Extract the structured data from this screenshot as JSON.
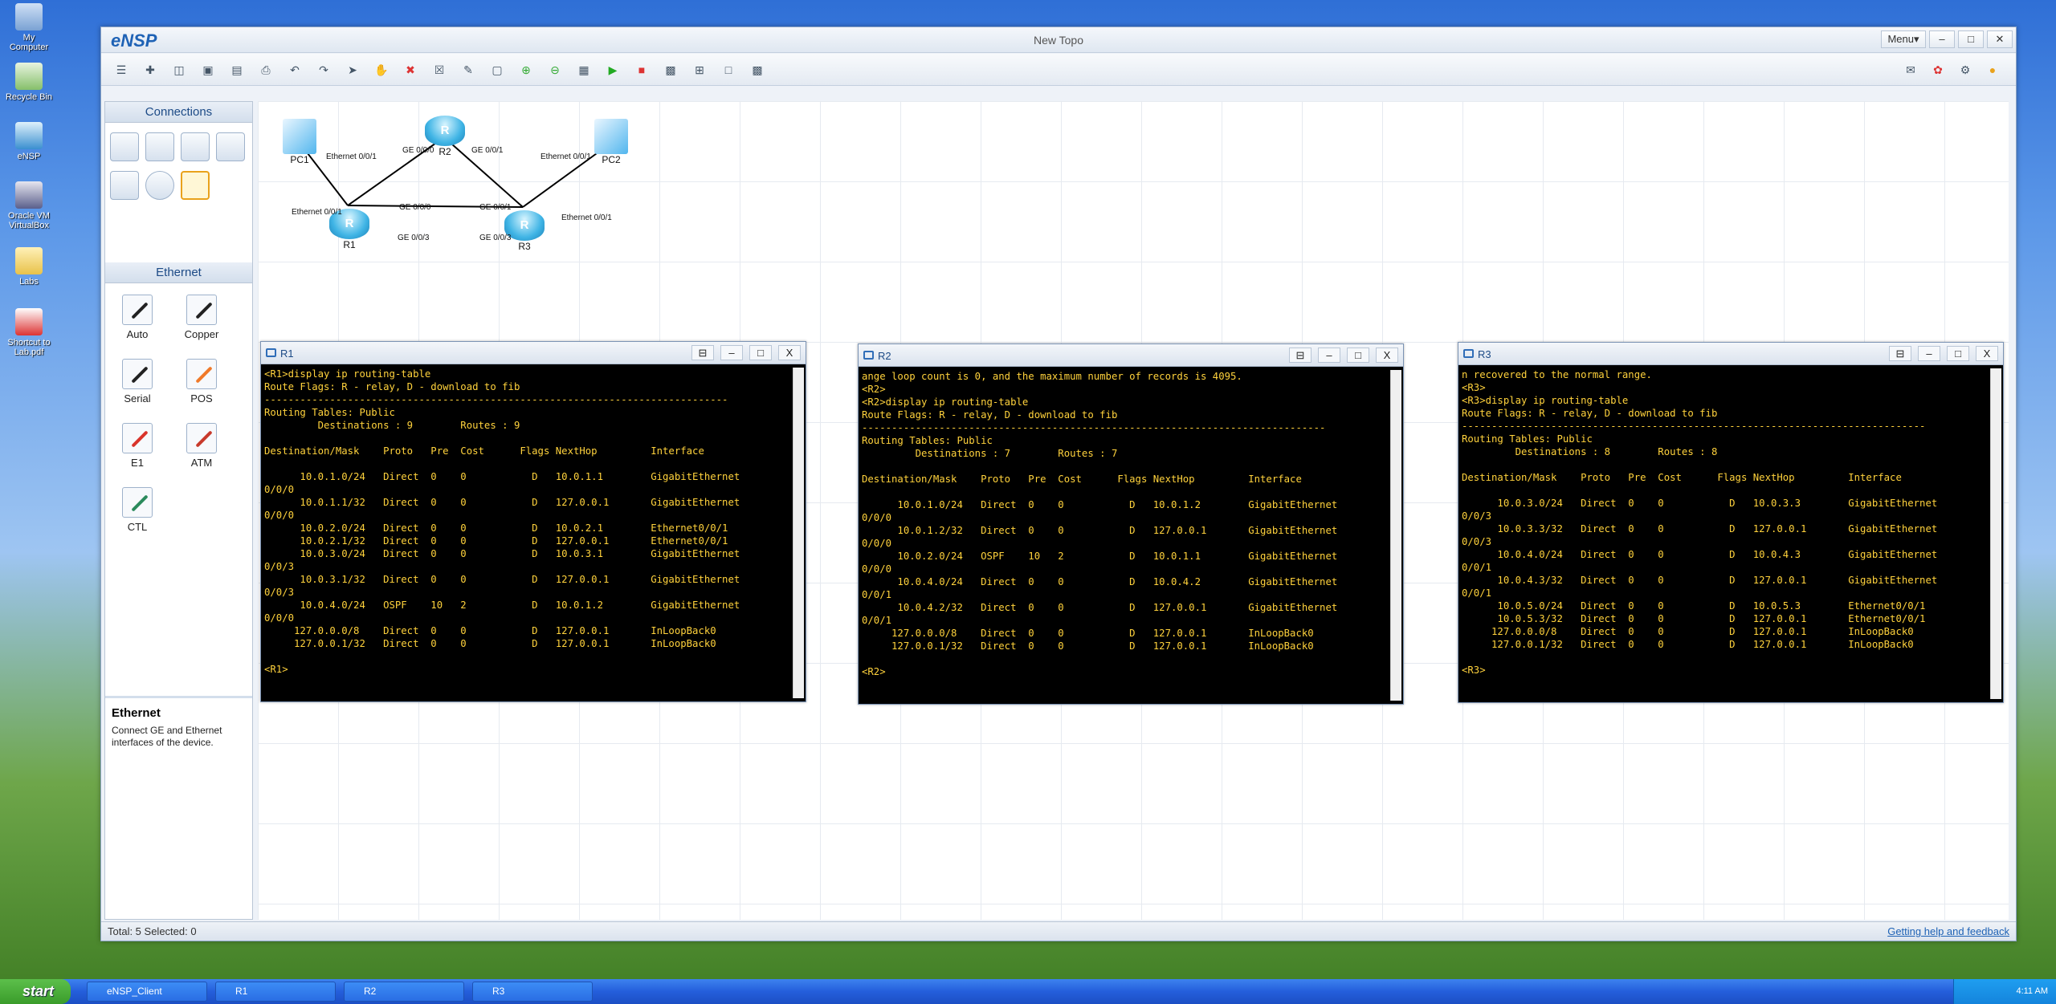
{
  "desktop": {
    "icons": [
      {
        "label": "My Computer",
        "name": "my-computer-icon"
      },
      {
        "label": "Recycle Bin",
        "name": "recycle-bin-icon"
      },
      {
        "label": "eNSP",
        "name": "ensp-icon"
      },
      {
        "label": "Oracle VM VirtualBox",
        "name": "virtualbox-icon"
      },
      {
        "label": "Labs",
        "name": "folder-icon"
      },
      {
        "label": "Shortcut to Lab.pdf",
        "name": "pdf-shortcut-icon"
      }
    ]
  },
  "app": {
    "logo": "eNSP",
    "title": "New Topo",
    "menu": "Menu▾",
    "min": "–",
    "max": "□",
    "close": "✕"
  },
  "panels": {
    "connections": "Connections",
    "ethernet": "Ethernet",
    "cables": [
      {
        "label": "Auto",
        "color": "#222"
      },
      {
        "label": "Copper",
        "color": "#222"
      },
      {
        "label": "Serial",
        "color": "#222"
      },
      {
        "label": "POS",
        "color": "#f07a2a"
      },
      {
        "label": "E1",
        "color": "#d9342b"
      },
      {
        "label": "ATM",
        "color": "#c83a2c"
      },
      {
        "label": "CTL",
        "color": "#2b8a5c"
      }
    ],
    "info_title": "Ethernet",
    "info_text": "Connect GE and Ethernet interfaces of the device."
  },
  "topology": {
    "nodes": {
      "pc1": "PC1",
      "pc2": "PC2",
      "r1": "R1",
      "r2": "R2",
      "r3": "R3"
    },
    "router_glyph": "R",
    "links": {
      "pc1_r1_a": "Ethernet 0/0/1",
      "pc1_r1_b": "Ethernet 0/0/1",
      "r1_r2_a": "GE 0/0/0",
      "r1_r2_b": "GE 0/0/0",
      "r2_r3_a": "GE 0/0/1",
      "r2_r3_b": "GE 0/0/1",
      "r1_r3_a": "GE 0/0/3",
      "r1_r3_b": "GE 0/0/3",
      "pc2_r3_a": "Ethernet 0/0/1",
      "pc2_r3_b": "Ethernet 0/0/1"
    }
  },
  "terminals": {
    "ctl": {
      "restore": "⊟",
      "min": "–",
      "max": "□",
      "close": "X"
    },
    "r1": {
      "title": "R1",
      "text": "<R1>display ip routing-table\nRoute Flags: R - relay, D - download to fib\n------------------------------------------------------------------------------\nRouting Tables: Public\n         Destinations : 9        Routes : 9\n\nDestination/Mask    Proto   Pre  Cost      Flags NextHop         Interface\n\n      10.0.1.0/24   Direct  0    0           D   10.0.1.1        GigabitEthernet\n0/0/0\n      10.0.1.1/32   Direct  0    0           D   127.0.0.1       GigabitEthernet\n0/0/0\n      10.0.2.0/24   Direct  0    0           D   10.0.2.1        Ethernet0/0/1\n      10.0.2.1/32   Direct  0    0           D   127.0.0.1       Ethernet0/0/1\n      10.0.3.0/24   Direct  0    0           D   10.0.3.1        GigabitEthernet\n0/0/3\n      10.0.3.1/32   Direct  0    0           D   127.0.0.1       GigabitEthernet\n0/0/3\n      10.0.4.0/24   OSPF    10   2           D   10.0.1.2        GigabitEthernet\n0/0/0\n     127.0.0.0/8    Direct  0    0           D   127.0.0.1       InLoopBack0\n     127.0.0.1/32   Direct  0    0           D   127.0.0.1       InLoopBack0\n\n<R1>"
    },
    "r2": {
      "title": "R2",
      "text": "ange loop count is 0, and the maximum number of records is 4095.\n<R2>\n<R2>display ip routing-table\nRoute Flags: R - relay, D - download to fib\n------------------------------------------------------------------------------\nRouting Tables: Public\n         Destinations : 7        Routes : 7\n\nDestination/Mask    Proto   Pre  Cost      Flags NextHop         Interface\n\n      10.0.1.0/24   Direct  0    0           D   10.0.1.2        GigabitEthernet\n0/0/0\n      10.0.1.2/32   Direct  0    0           D   127.0.0.1       GigabitEthernet\n0/0/0\n      10.0.2.0/24   OSPF    10   2           D   10.0.1.1        GigabitEthernet\n0/0/0\n      10.0.4.0/24   Direct  0    0           D   10.0.4.2        GigabitEthernet\n0/0/1\n      10.0.4.2/32   Direct  0    0           D   127.0.0.1       GigabitEthernet\n0/0/1\n     127.0.0.0/8    Direct  0    0           D   127.0.0.1       InLoopBack0\n     127.0.0.1/32   Direct  0    0           D   127.0.0.1       InLoopBack0\n\n<R2>"
    },
    "r3": {
      "title": "R3",
      "text": "n recovered to the normal range.\n<R3>\n<R3>display ip routing-table\nRoute Flags: R - relay, D - download to fib\n------------------------------------------------------------------------------\nRouting Tables: Public\n         Destinations : 8        Routes : 8\n\nDestination/Mask    Proto   Pre  Cost      Flags NextHop         Interface\n\n      10.0.3.0/24   Direct  0    0           D   10.0.3.3        GigabitEthernet\n0/0/3\n      10.0.3.3/32   Direct  0    0           D   127.0.0.1       GigabitEthernet\n0/0/3\n      10.0.4.0/24   Direct  0    0           D   10.0.4.3        GigabitEthernet\n0/0/1\n      10.0.4.3/32   Direct  0    0           D   127.0.0.1       GigabitEthernet\n0/0/1\n      10.0.5.0/24   Direct  0    0           D   10.0.5.3        Ethernet0/0/1\n      10.0.5.3/32   Direct  0    0           D   127.0.0.1       Ethernet0/0/1\n     127.0.0.0/8    Direct  0    0           D   127.0.0.1       InLoopBack0\n     127.0.0.1/32   Direct  0    0           D   127.0.0.1       InLoopBack0\n\n<R3>"
    }
  },
  "status": {
    "left": "Total: 5  Selected: 0",
    "help": "Getting help and feedback"
  },
  "taskbar": {
    "start": "start",
    "tasks": [
      "eNSP_Client",
      "R1",
      "R2",
      "R3"
    ],
    "clock": "4:11 AM"
  }
}
